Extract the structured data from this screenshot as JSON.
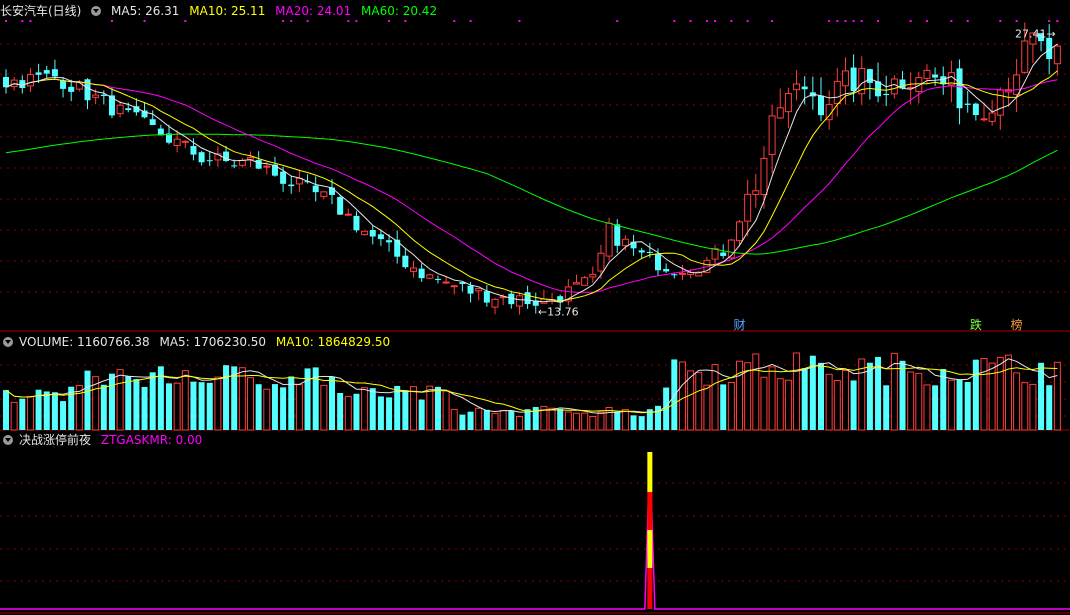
{
  "main_header": {
    "title": "长安汽车(日线)",
    "ma5": "MA5: 26.31",
    "ma10": "MA10: 25.11",
    "ma20": "MA20: 24.01",
    "ma60": "MA60: 20.42"
  },
  "volume_header": {
    "volume": "VOLUME: 1160766.38",
    "ma5": "MA5: 1706230.50",
    "ma10": "MA10: 1864829.50"
  },
  "indicator_header": {
    "name": "决战涨停前夜",
    "value": "ZTGASKMR: 0.00"
  },
  "colors": {
    "up": "#ff3c3c",
    "down": "#54ffff",
    "ma5": "#e6e6e6",
    "ma10": "#ffff00",
    "ma20": "#ff00ff",
    "ma60": "#00ff00",
    "grid": "#8b0000"
  },
  "chart_data": [
    {
      "type": "candlestick",
      "title": "长安汽车(日线)",
      "annotations": {
        "high_label": "27.41",
        "low_label": "13.76",
        "event_markers": [
          "财",
          "跌",
          "榜"
        ]
      },
      "series": [
        {
          "name": "MA5",
          "last": 26.31
        },
        {
          "name": "MA10",
          "last": 25.11
        },
        {
          "name": "MA20",
          "last": 24.01
        },
        {
          "name": "MA60",
          "last": 20.42
        }
      ],
      "price_path": [
        [
          0,
          25.2
        ],
        [
          6,
          25.5
        ],
        [
          10,
          24.6
        ],
        [
          16,
          23.2
        ],
        [
          20,
          22.3
        ],
        [
          24,
          21.3
        ],
        [
          28,
          21.0
        ],
        [
          30,
          21.1
        ],
        [
          35,
          20.0
        ],
        [
          40,
          19.0
        ],
        [
          44,
          17.5
        ],
        [
          48,
          16.2
        ],
        [
          52,
          15.1
        ],
        [
          57,
          14.4
        ],
        [
          62,
          14.0
        ],
        [
          66,
          13.85
        ],
        [
          72,
          14.9
        ],
        [
          74,
          17.5
        ],
        [
          78,
          16.2
        ],
        [
          82,
          15.6
        ],
        [
          86,
          15.9
        ],
        [
          88,
          16.5
        ],
        [
          92,
          20.0
        ],
        [
          95,
          24.0
        ],
        [
          98,
          25.0
        ],
        [
          100,
          24.2
        ],
        [
          104,
          25.3
        ],
        [
          108,
          25.0
        ],
        [
          112,
          25.8
        ],
        [
          116,
          24.9
        ],
        [
          119,
          23.8
        ],
        [
          121,
          24.4
        ],
        [
          124,
          26.0
        ],
        [
          126,
          27.3
        ],
        [
          128,
          26.5
        ]
      ],
      "ylim": [
        12.5,
        28.0
      ]
    },
    {
      "type": "bar",
      "title": "VOLUME",
      "series": [
        {
          "name": "VOLUME",
          "last": 1160766.38
        },
        {
          "name": "MA5",
          "last": 1706230.5
        },
        {
          "name": "MA10",
          "last": 1864829.5
        }
      ]
    },
    {
      "type": "bar",
      "title": "决战涨停前夜",
      "series": [
        {
          "name": "ZTGASKMR",
          "last": 0.0,
          "signal_bar_index": 79
        }
      ]
    }
  ]
}
